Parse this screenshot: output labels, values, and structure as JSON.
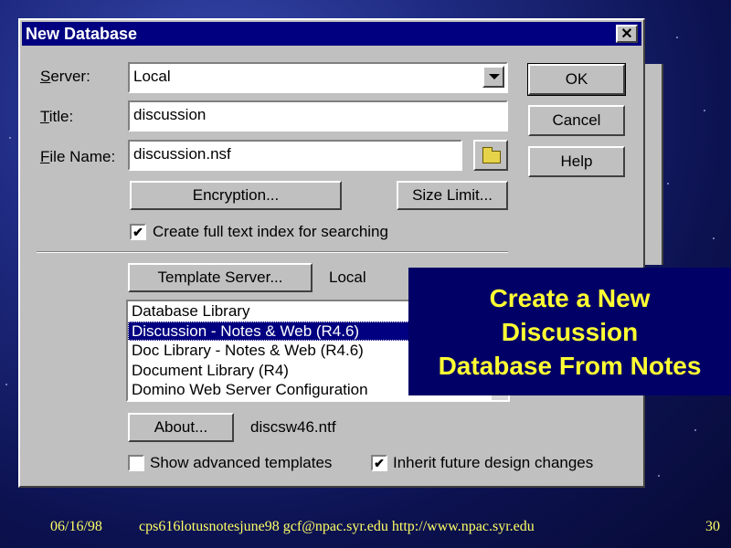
{
  "dialog": {
    "title": "New Database",
    "close_glyph": "✕",
    "server": {
      "label_u": "S",
      "label_rest": "erver:",
      "value": "Local"
    },
    "title_field": {
      "label_u": "T",
      "label_rest": "itle:",
      "value": "discussion"
    },
    "filename": {
      "label_u": "F",
      "label_rest": "ile Name:",
      "value": "discussion.nsf"
    },
    "buttons": {
      "ok": "OK",
      "cancel": "Cancel",
      "help": "Help",
      "encryption": "Encryption...",
      "size_limit": "Size Limit...",
      "template_server": "Template Server...",
      "about": "About..."
    },
    "fulltext_checkbox": {
      "checked": true,
      "label": "Create full text index for searching"
    },
    "template_server_value": "Local",
    "templates": [
      "Database Library",
      "Discussion - Notes & Web (R4.6)",
      "Doc Library - Notes & Web (R4.6)",
      "Document Library (R4)",
      "Domino Web Server Configuration"
    ],
    "selected_template_index": 1,
    "template_file": "discsw46.ntf",
    "show_advanced": {
      "checked": false,
      "label": "Show advanced templates"
    },
    "inherit_design": {
      "checked": true,
      "label": "Inherit future design changes"
    }
  },
  "overlay": {
    "line1": "Create a New",
    "line2": "Discussion",
    "line3": "Database From Notes"
  },
  "footer": {
    "date": "06/16/98",
    "source": "cps616lotusnotesjune98  gcf@npac.syr.edu http://www.npac.syr.edu",
    "page": "30"
  },
  "colors": {
    "titlebar": "#000080",
    "overlay_bg": "#000066",
    "overlay_text": "#ffff33",
    "footer_text": "#ffff66"
  }
}
